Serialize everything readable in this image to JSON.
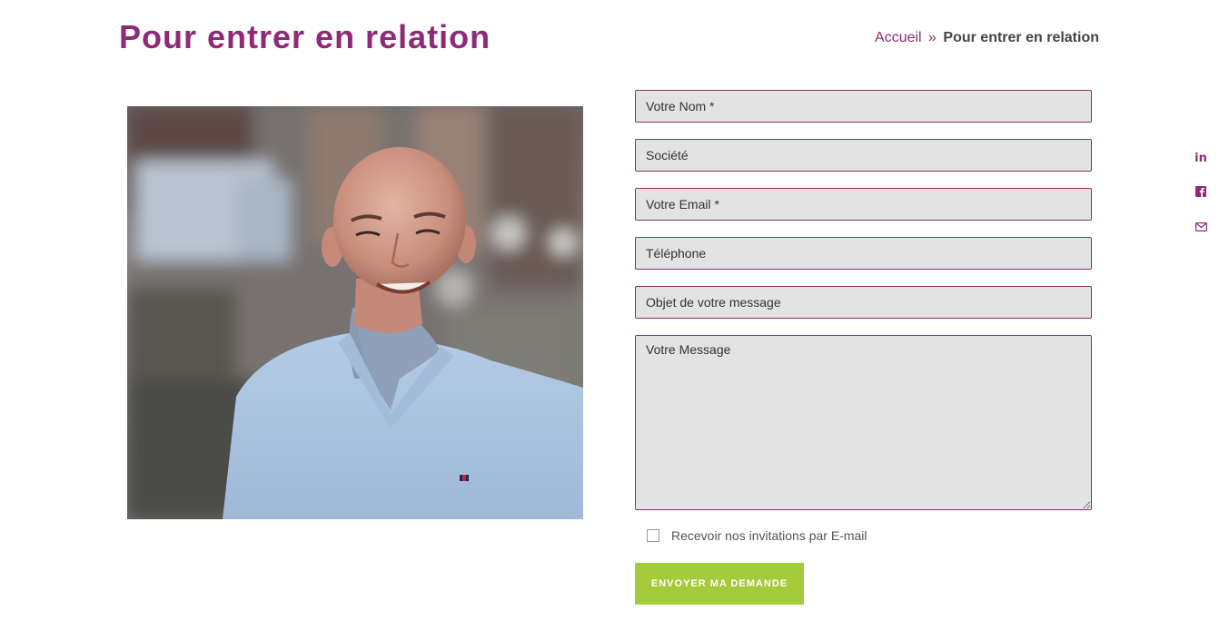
{
  "header": {
    "title": "Pour entrer en relation",
    "breadcrumb": {
      "home": "Accueil",
      "separator": "»",
      "current": "Pour entrer en relation"
    }
  },
  "photo": {
    "description_icon": "portrait-photo"
  },
  "form": {
    "fields": [
      {
        "placeholder": "Votre Nom *",
        "value": ""
      },
      {
        "placeholder": "Société",
        "value": ""
      },
      {
        "placeholder": "Votre Email *",
        "value": ""
      },
      {
        "placeholder": "Téléphone",
        "value": ""
      },
      {
        "placeholder": "Objet de votre message",
        "value": ""
      }
    ],
    "message": {
      "placeholder": "Votre Message",
      "value": ""
    },
    "checkbox_label": "Recevoir nos invitations par E-mail",
    "checkbox_checked": false,
    "submit_label": "ENVOYER MA DEMANDE"
  },
  "social": {
    "linkedin_label": "in",
    "icons": [
      "linkedin-icon",
      "facebook-icon",
      "mail-icon"
    ]
  },
  "colors": {
    "brand": "#8e2b78",
    "submit": "#a4cb3a",
    "field_bg": "#e4e3e4"
  }
}
